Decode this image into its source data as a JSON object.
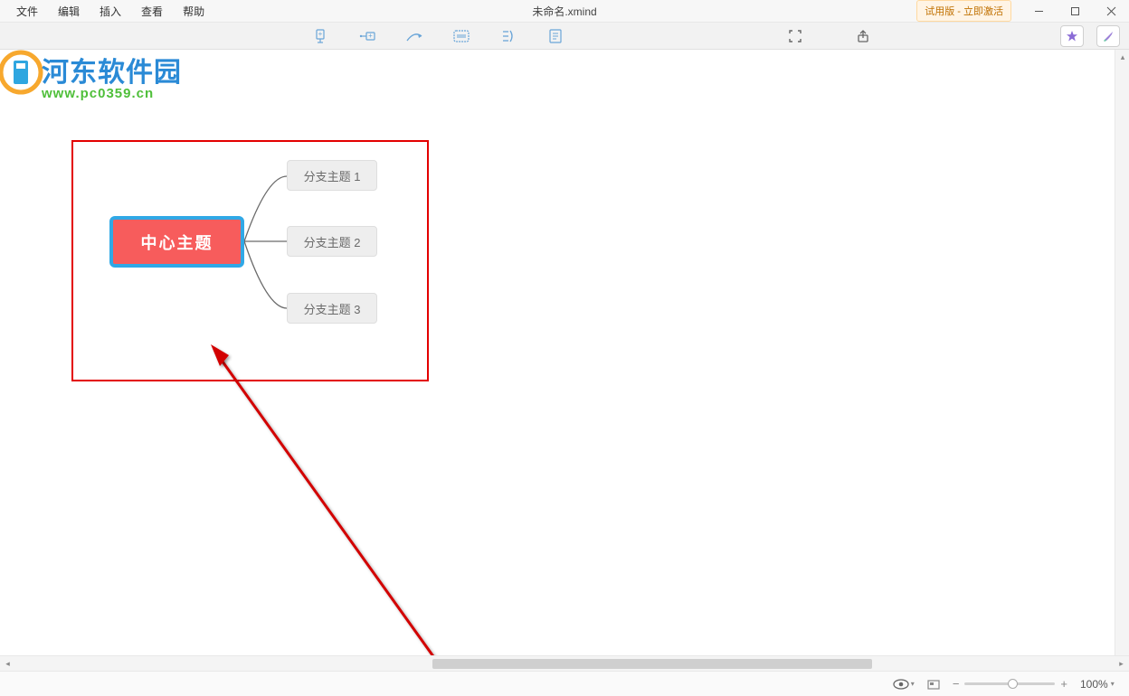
{
  "menu": {
    "file": "文件",
    "edit": "编辑",
    "insert": "插入",
    "view": "查看",
    "help": "帮助"
  },
  "title": "未命名.xmind",
  "trial": "试用版 - 立即激活",
  "watermark": {
    "line1": "河东软件园",
    "url": "www.pc0359.cn"
  },
  "mindmap": {
    "central": "中心主题",
    "branches": [
      "分支主题 1",
      "分支主题 2",
      "分支主题 3"
    ]
  },
  "status": {
    "zoom": "100%"
  },
  "icons": {
    "subtopic": "subtopic",
    "childtopic": "childtopic",
    "relationship": "relationship",
    "boundary": "boundary",
    "summary": "summary",
    "note": "note",
    "fitmap": "fitmap",
    "share": "share",
    "star": "star",
    "format": "format"
  }
}
